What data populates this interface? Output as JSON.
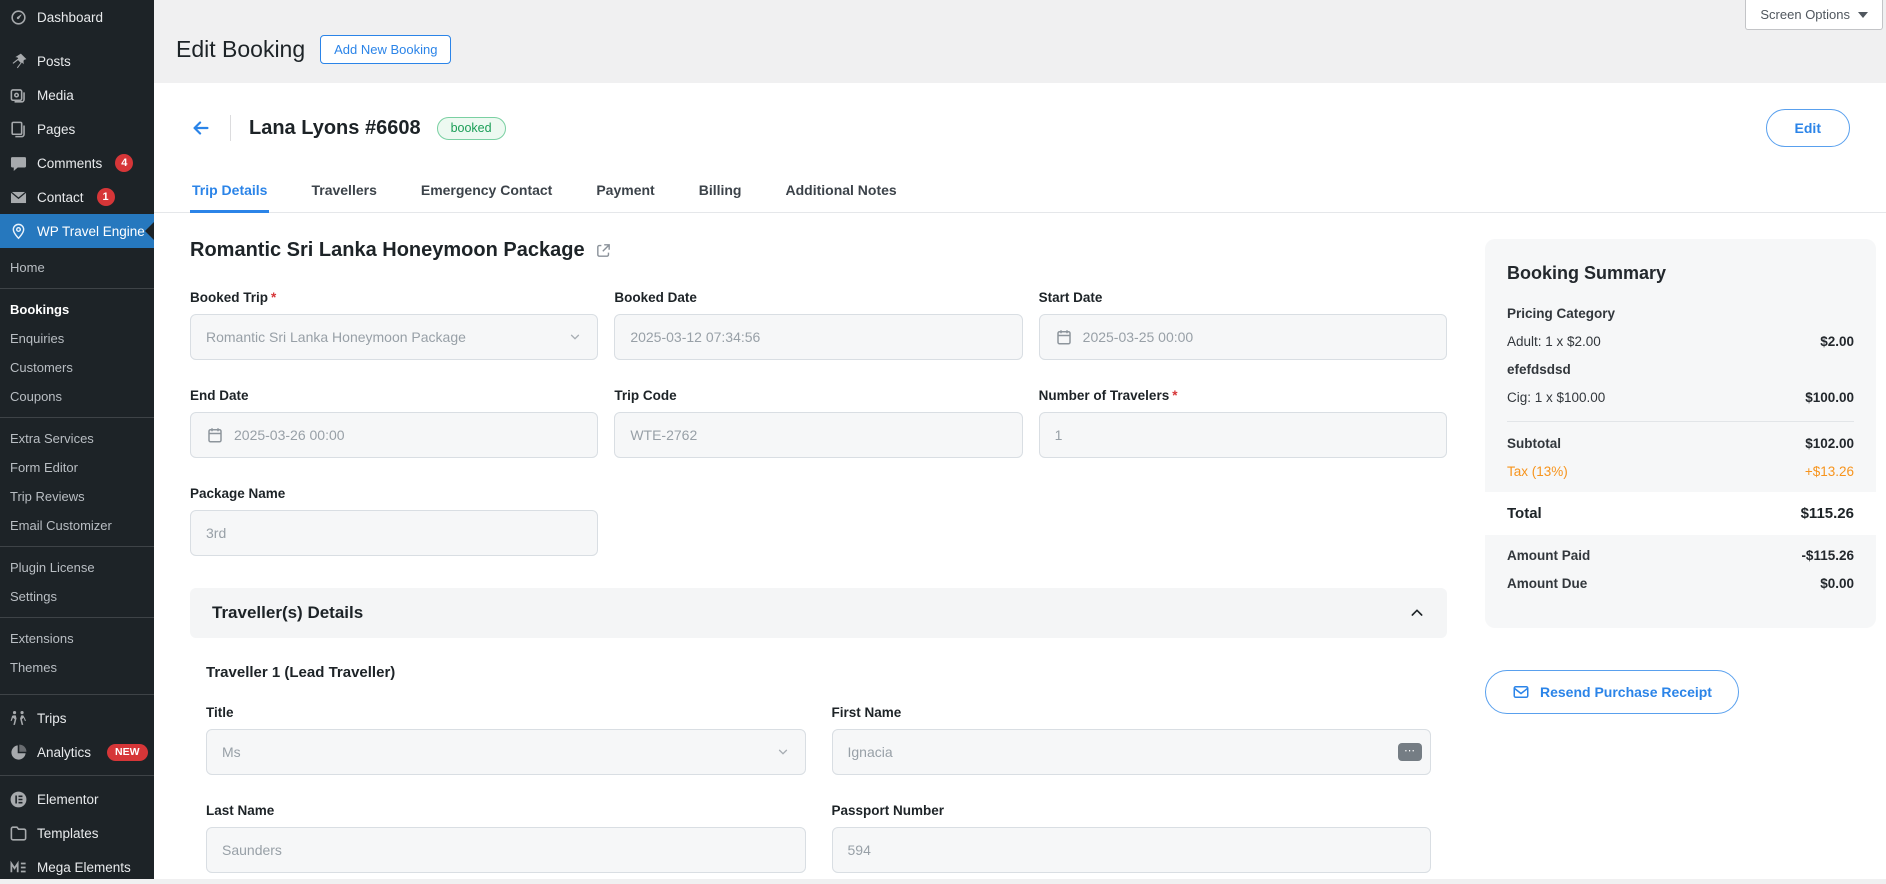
{
  "ui": {
    "required_mark": "*"
  },
  "colors": {
    "sidebar_bg": "#1d2327",
    "sidebar_active": "#2678be",
    "accent_blue": "#2b84e8",
    "status_green": "#1b9e57",
    "tax_orange": "#f7941d",
    "badge_red": "#d63638"
  },
  "sidebar": {
    "top_items": [
      {
        "label": "Dashboard"
      },
      {
        "label": "Posts"
      },
      {
        "label": "Media"
      },
      {
        "label": "Pages"
      },
      {
        "label": "Comments",
        "badge": "4"
      },
      {
        "label": "Contact",
        "badge": "1"
      },
      {
        "label": "WP Travel Engine"
      }
    ],
    "submenu": [
      "Home",
      "Bookings",
      "Enquiries",
      "Customers",
      "Coupons",
      "Extra Services",
      "Form Editor",
      "Trip Reviews",
      "Email Customizer",
      "Plugin License",
      "Settings",
      "Extensions",
      "Themes"
    ],
    "bottom_items": [
      {
        "label": "Trips"
      },
      {
        "label": "Analytics",
        "badge": "NEW"
      },
      {
        "label": "Elementor"
      },
      {
        "label": "Templates"
      },
      {
        "label": "Mega Elements"
      }
    ]
  },
  "page_header": {
    "title": "Edit Booking",
    "add_new": "Add New Booking",
    "screen_options": "Screen Options"
  },
  "booking": {
    "customer": "Lana Lyons #6608",
    "status": "booked",
    "edit": "Edit"
  },
  "tabs": [
    {
      "label": "Trip Details"
    },
    {
      "label": "Travellers"
    },
    {
      "label": "Emergency Contact"
    },
    {
      "label": "Payment"
    },
    {
      "label": "Billing"
    },
    {
      "label": "Additional Notes"
    }
  ],
  "trip_form": {
    "title": "Romantic Sri Lanka Honeymoon Package",
    "fields": {
      "booked_trip": {
        "label": "Booked Trip",
        "value": "Romantic Sri Lanka Honeymoon Package"
      },
      "booked_date": {
        "label": "Booked Date",
        "value": "2025-03-12 07:34:56"
      },
      "start_date": {
        "label": "Start Date",
        "value": "2025-03-25 00:00"
      },
      "end_date": {
        "label": "End Date",
        "value": "2025-03-26 00:00"
      },
      "trip_code": {
        "label": "Trip Code",
        "value": "WTE-2762"
      },
      "num_travelers": {
        "label": "Number of Travelers",
        "value": "1"
      },
      "package_name": {
        "label": "Package Name",
        "value": "3rd"
      }
    }
  },
  "traveller": {
    "section_title": "Traveller(s) Details",
    "subtitle": "Traveller 1 (Lead Traveller)",
    "fields": {
      "title": {
        "label": "Title",
        "value": "Ms"
      },
      "first_name": {
        "label": "First Name",
        "value": "Ignacia"
      },
      "last_name": {
        "label": "Last Name",
        "value": "Saunders"
      },
      "passport": {
        "label": "Passport Number",
        "value": "594"
      }
    }
  },
  "summary": {
    "title": "Booking Summary",
    "pricing_category_label": "Pricing Category",
    "adult_line": {
      "label": "Adult: 1 x $2.00",
      "value": "$2.00"
    },
    "extra_group_label": "efefdsdsd",
    "cig_line": {
      "label": "Cig: 1 x $100.00",
      "value": "$100.00"
    },
    "subtotal_label": "Subtotal",
    "subtotal_value": "$102.00",
    "tax_label": "Tax (13%)",
    "tax_value": "+$13.26",
    "total_label": "Total",
    "total_value": "$115.26",
    "paid_label": "Amount Paid",
    "paid_value": "-$115.26",
    "due_label": "Amount Due",
    "due_value": "$0.00",
    "resend_label": "Resend Purchase Receipt"
  }
}
